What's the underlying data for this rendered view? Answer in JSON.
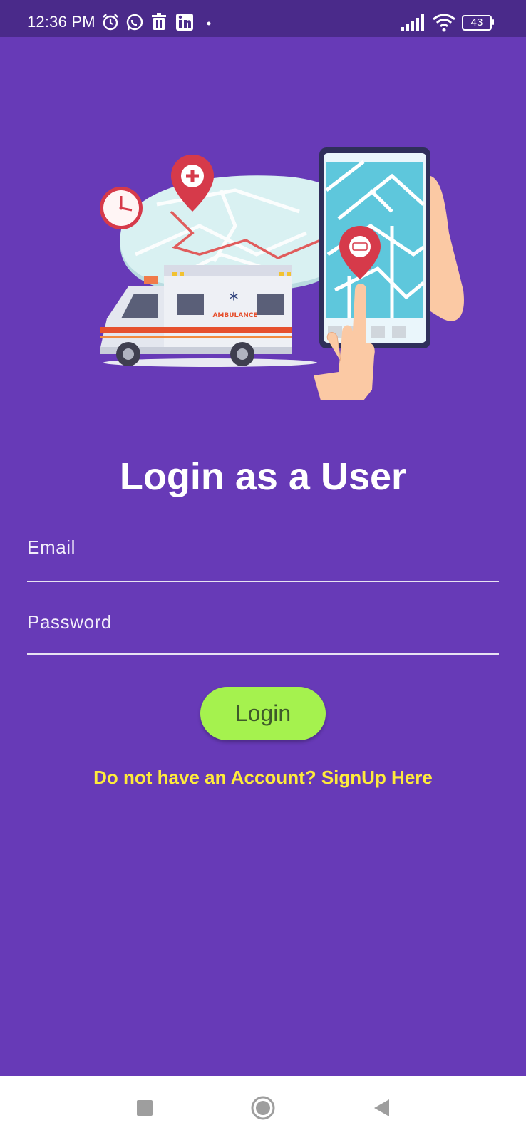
{
  "status_bar": {
    "time": "12:36 PM",
    "battery": "43",
    "icons": [
      "alarm-icon",
      "whatsapp-icon",
      "trash-icon",
      "linkedin-icon",
      "dot-icon",
      "signal-icon",
      "wifi-icon",
      "battery-icon"
    ]
  },
  "hero": {
    "ambulance_text": "AMBULANCE"
  },
  "login": {
    "title": "Login as a User",
    "email_label": "Email",
    "password_label": "Password",
    "login_button": "Login",
    "signup_link": "Do not have an Account? SignUp Here"
  },
  "nav": {
    "icons": [
      "recents-square-icon",
      "home-circle-icon",
      "back-triangle-icon"
    ]
  },
  "colors": {
    "background": "#673ab7",
    "status_bar": "#4a2a8a",
    "button": "#a5f24e",
    "button_text": "#3e5a2a",
    "link": "#ffeb3b"
  }
}
